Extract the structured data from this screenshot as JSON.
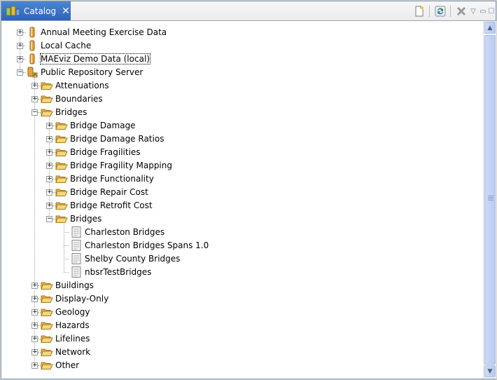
{
  "tab": {
    "title": "Catalog",
    "close": "✕"
  },
  "toolbar": {
    "new": "new-icon",
    "refresh": "refresh-icon",
    "remove": "remove-icon",
    "menu": "▽",
    "minimize": "▭",
    "maximize": "☐"
  },
  "tree": {
    "roots": [
      {
        "label": "Annual Meeting Exercise Data",
        "expanded": false,
        "icon": "database-icon"
      },
      {
        "label": "Local Cache",
        "expanded": false,
        "icon": "database-icon"
      },
      {
        "label": "MAEviz Demo Data (local)",
        "expanded": false,
        "icon": "database-icon",
        "focused": true
      },
      {
        "label": "Public Repository Server",
        "expanded": true,
        "icon": "server-icon"
      }
    ],
    "server_children": [
      {
        "label": "Attenuations"
      },
      {
        "label": "Boundaries"
      },
      {
        "label": "Bridges"
      },
      {
        "label": "Buildings"
      },
      {
        "label": "Display-Only"
      },
      {
        "label": "Geology"
      },
      {
        "label": "Hazards"
      },
      {
        "label": "Lifelines"
      },
      {
        "label": "Network"
      },
      {
        "label": "Other"
      }
    ],
    "bridges_children": [
      {
        "label": "Bridge Damage"
      },
      {
        "label": "Bridge Damage Ratios"
      },
      {
        "label": "Bridge Fragilities"
      },
      {
        "label": "Bridge Fragility Mapping"
      },
      {
        "label": "Bridge Functionality"
      },
      {
        "label": "Bridge Repair Cost"
      },
      {
        "label": "Bridge Retrofit Cost"
      },
      {
        "label": "Bridges"
      }
    ],
    "bridges_datasets": [
      {
        "label": "Charleston Bridges"
      },
      {
        "label": "Charleston Bridges Spans 1.0"
      },
      {
        "label": "Shelby County Bridges"
      },
      {
        "label": "nbsrTestBridges"
      }
    ]
  },
  "colors": {
    "tab_bg": "#3b74c8",
    "folder": "#f2c94c",
    "db_orange": "#e7a23a"
  }
}
